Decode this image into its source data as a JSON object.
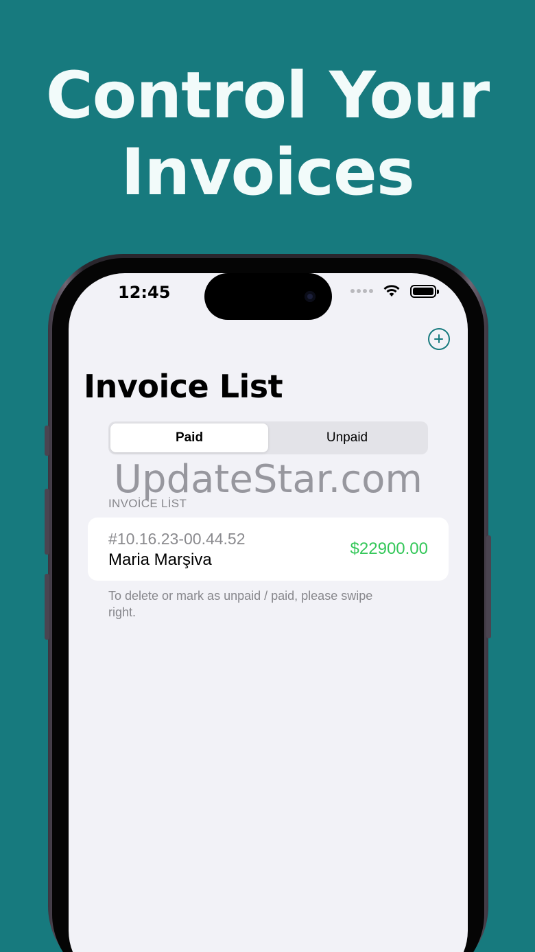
{
  "headline": {
    "line1": "Control Your",
    "line2": "Invoices"
  },
  "status_bar": {
    "time": "12:45"
  },
  "nav": {
    "add_icon": "plus-circle-icon"
  },
  "page": {
    "title": "Invoice List"
  },
  "segments": {
    "paid": "Paid",
    "unpaid": "Unpaid",
    "selected": "Paid"
  },
  "watermark": "UpdateStar.com",
  "section": {
    "header": "INVOİCE LİST"
  },
  "invoices": [
    {
      "number": "#10.16.23-00.44.52",
      "name": "Maria Marşiva",
      "amount": "$22900.00"
    }
  ],
  "footer_note": "To delete or mark as unpaid / paid, please swipe right.",
  "colors": {
    "background": "#177a7e",
    "accent": "#177a7e",
    "amount": "#34c759"
  }
}
